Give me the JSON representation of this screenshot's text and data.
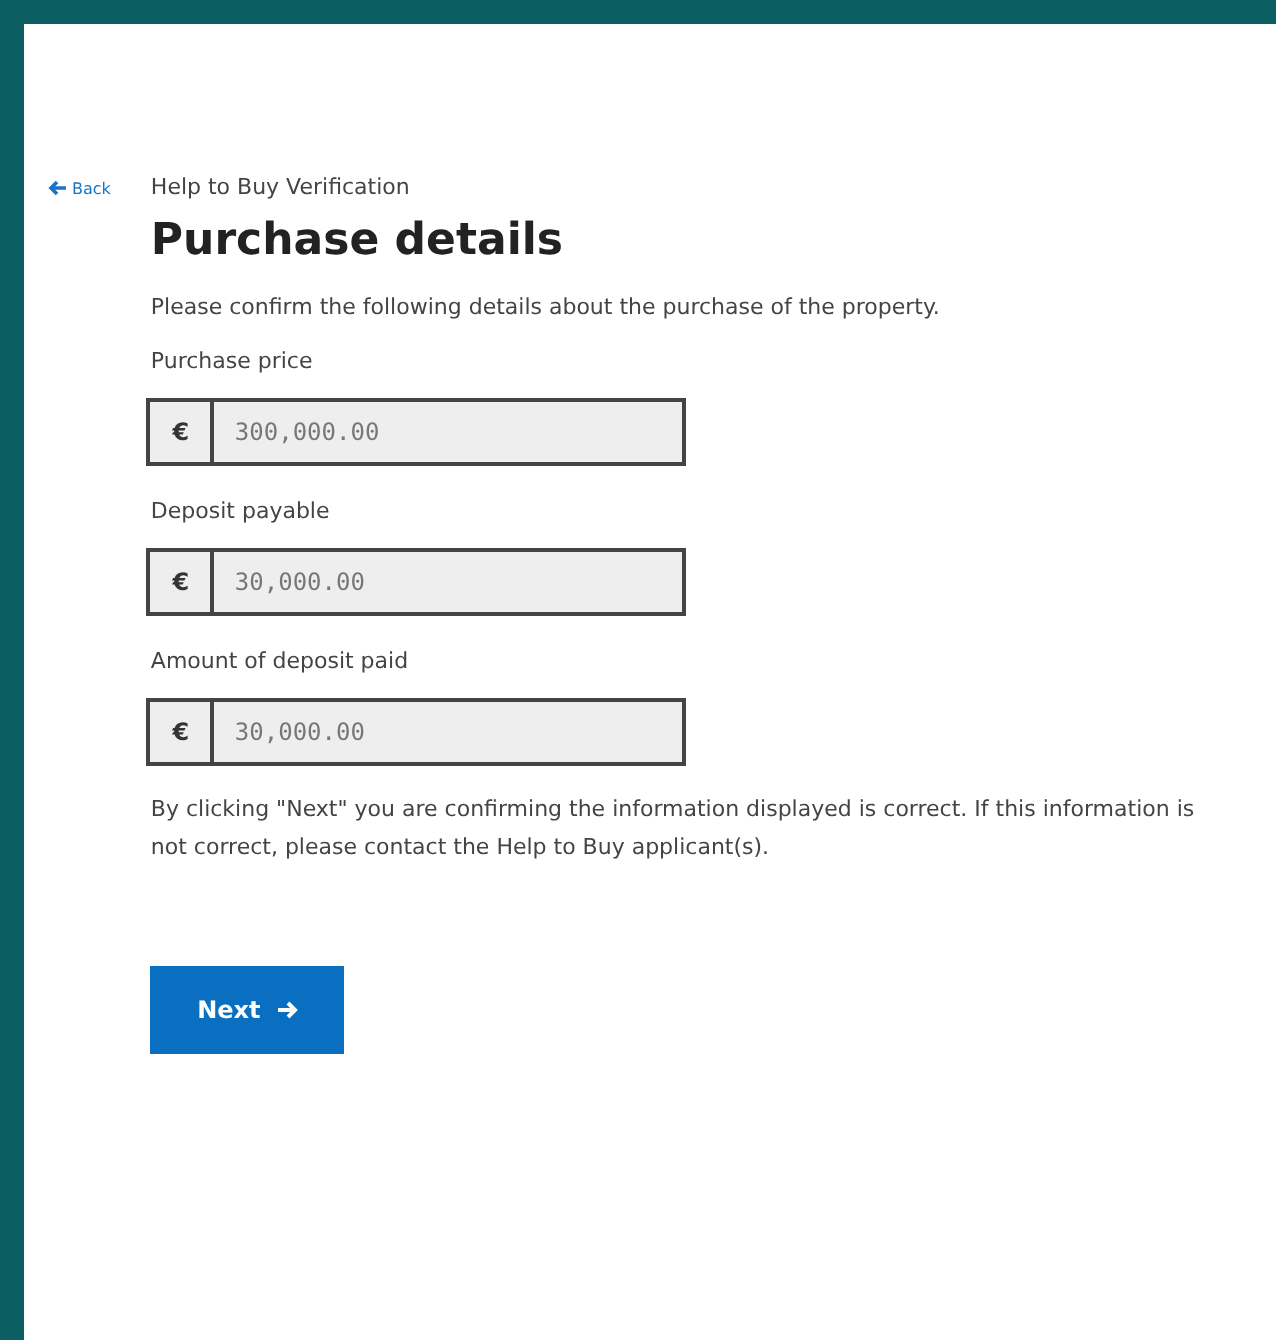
{
  "back_link": {
    "label": "Back"
  },
  "breadcrumb": "Help to Buy Verification",
  "title": "Purchase details",
  "intro": "Please confirm the following details about the purchase of the property.",
  "fields": [
    {
      "label": "Purchase price",
      "prefix": "€",
      "value": "300,000.00"
    },
    {
      "label": "Deposit payable",
      "prefix": "€",
      "value": "30,000.00"
    },
    {
      "label": "Amount of deposit paid",
      "prefix": "€",
      "value": "30,000.00"
    }
  ],
  "disclaimer": "By clicking \"Next\" you are confirming the information displayed is correct. If this information is not correct, please contact the Help to Buy applicant(s).",
  "next_button": {
    "label": "Next"
  }
}
